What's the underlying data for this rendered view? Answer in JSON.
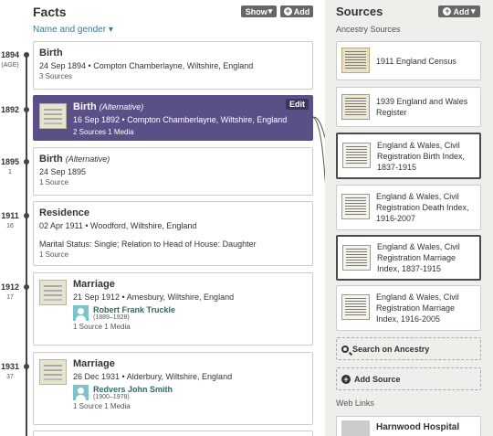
{
  "facts": {
    "title": "Facts",
    "show_label": "Show",
    "add_label": "Add",
    "name_gender_link": "Name and gender"
  },
  "timeline": [
    {
      "year": "1894",
      "age": "(AGE)"
    },
    {
      "year": "1892",
      "age": ""
    },
    {
      "year": "1895",
      "age": "1"
    },
    {
      "year": "1911",
      "age": "16"
    },
    {
      "year": "1912",
      "age": "17"
    },
    {
      "year": "1931",
      "age": "37"
    }
  ],
  "cards": [
    {
      "title": "Birth",
      "alt": "",
      "detail": "24 Sep 1894 • Compton Chamberlayne, Wiltshire, England",
      "meta": "3 Sources"
    },
    {
      "title": "Birth",
      "alt": "(Alternative)",
      "detail": "16 Sep 1892 • Compton Chamberlayne, Wiltshire, England",
      "meta": "2 Sources    1 Media",
      "edit": "Edit"
    },
    {
      "title": "Birth",
      "alt": "(Alternative)",
      "detail": "24 Sep 1895",
      "meta": "1 Source"
    },
    {
      "title": "Residence",
      "alt": "",
      "detail": "02 Apr 1911 • Woodford, Wiltshire, England",
      "detail2": "Marital Status: Single; Relation to Head of House: Daughter",
      "meta": "1 Source"
    },
    {
      "title": "Marriage",
      "alt": "",
      "detail": "21 Sep 1912 • Amesbury, Wiltshire, England",
      "spouse": "Robert Frank Truckle",
      "spouse_years": "(1889–1928)",
      "meta": "1 Source    1 Media"
    },
    {
      "title": "Marriage",
      "alt": "",
      "detail": "26 Dec 1931 • Alderbury, Wiltshire, England",
      "spouse": "Redvers John Smith",
      "spouse_years": "(1900–1978)",
      "meta": "1 Source    1 Media"
    }
  ],
  "sources": {
    "title": "Sources",
    "add_label": "Add",
    "ancestry_heading": "Ancestry Sources",
    "items": [
      {
        "label": "1911 England Census"
      },
      {
        "label": "1939 England and Wales Register"
      },
      {
        "label": "England & Wales, Civil Registration Birth Index, 1837-1915"
      },
      {
        "label": "England & Wales, Civil Registration Death Index, 1916-2007"
      },
      {
        "label": "England & Wales, Civil Registration Marriage Index, 1837-1915"
      },
      {
        "label": "England & Wales, Civil Registration Marriage Index, 1916-2005"
      }
    ],
    "search_label": "Search on Ancestry",
    "add_source_label": "Add Source",
    "web_links_heading": "Web Links",
    "web_link": "Harnwood Hospital"
  },
  "colors": {
    "selected_card": "#5b4f87",
    "accent_link": "#3a7a93",
    "spouse_link": "#2f6b66"
  },
  "icons": [
    "chevron-down-icon",
    "plus-icon",
    "search-icon",
    "person-icon",
    "document-icon",
    "link-icon"
  ]
}
